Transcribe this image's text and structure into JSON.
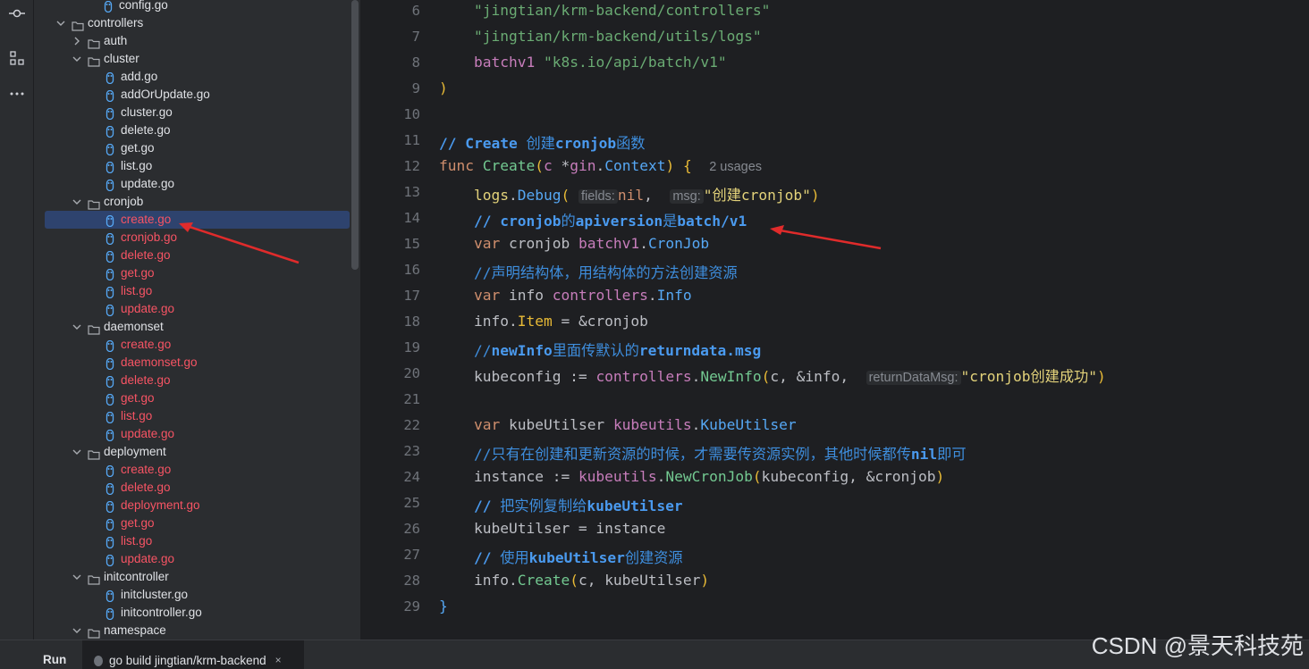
{
  "tree": {
    "items": [
      {
        "label": "config.go",
        "kind": "file",
        "depth": 4,
        "red": false
      },
      {
        "label": "controllers",
        "kind": "folder",
        "depth": 1,
        "open": true
      },
      {
        "label": "auth",
        "kind": "folder",
        "depth": 2,
        "open": false
      },
      {
        "label": "cluster",
        "kind": "folder",
        "depth": 2,
        "open": true
      },
      {
        "label": "add.go",
        "kind": "file",
        "depth": 3,
        "red": false
      },
      {
        "label": "addOrUpdate.go",
        "kind": "file",
        "depth": 3,
        "red": false
      },
      {
        "label": "cluster.go",
        "kind": "file",
        "depth": 3,
        "red": false
      },
      {
        "label": "delete.go",
        "kind": "file",
        "depth": 3,
        "red": false
      },
      {
        "label": "get.go",
        "kind": "file",
        "depth": 3,
        "red": false
      },
      {
        "label": "list.go",
        "kind": "file",
        "depth": 3,
        "red": false
      },
      {
        "label": "update.go",
        "kind": "file",
        "depth": 3,
        "red": false
      },
      {
        "label": "cronjob",
        "kind": "folder",
        "depth": 2,
        "open": true
      },
      {
        "label": "create.go",
        "kind": "file",
        "depth": 3,
        "red": true,
        "selected": true
      },
      {
        "label": "cronjob.go",
        "kind": "file",
        "depth": 3,
        "red": true
      },
      {
        "label": "delete.go",
        "kind": "file",
        "depth": 3,
        "red": true
      },
      {
        "label": "get.go",
        "kind": "file",
        "depth": 3,
        "red": true
      },
      {
        "label": "list.go",
        "kind": "file",
        "depth": 3,
        "red": true
      },
      {
        "label": "update.go",
        "kind": "file",
        "depth": 3,
        "red": true
      },
      {
        "label": "daemonset",
        "kind": "folder",
        "depth": 2,
        "open": true
      },
      {
        "label": "create.go",
        "kind": "file",
        "depth": 3,
        "red": true
      },
      {
        "label": "daemonset.go",
        "kind": "file",
        "depth": 3,
        "red": true
      },
      {
        "label": "delete.go",
        "kind": "file",
        "depth": 3,
        "red": true
      },
      {
        "label": "get.go",
        "kind": "file",
        "depth": 3,
        "red": true
      },
      {
        "label": "list.go",
        "kind": "file",
        "depth": 3,
        "red": true
      },
      {
        "label": "update.go",
        "kind": "file",
        "depth": 3,
        "red": true
      },
      {
        "label": "deployment",
        "kind": "folder",
        "depth": 2,
        "open": true
      },
      {
        "label": "create.go",
        "kind": "file",
        "depth": 3,
        "red": true
      },
      {
        "label": "delete.go",
        "kind": "file",
        "depth": 3,
        "red": true
      },
      {
        "label": "deployment.go",
        "kind": "file",
        "depth": 3,
        "red": true
      },
      {
        "label": "get.go",
        "kind": "file",
        "depth": 3,
        "red": true
      },
      {
        "label": "list.go",
        "kind": "file",
        "depth": 3,
        "red": true
      },
      {
        "label": "update.go",
        "kind": "file",
        "depth": 3,
        "red": true
      },
      {
        "label": "initcontroller",
        "kind": "folder",
        "depth": 2,
        "open": true
      },
      {
        "label": "initcluster.go",
        "kind": "file",
        "depth": 3,
        "red": false
      },
      {
        "label": "initcontroller.go",
        "kind": "file",
        "depth": 3,
        "red": false
      },
      {
        "label": "namespace",
        "kind": "folder",
        "depth": 2,
        "open": true
      }
    ]
  },
  "editor": {
    "lines": [
      {
        "n": "6",
        "html": "    <span class='str'>\"jingtian/krm-backend/controllers\"</span>"
      },
      {
        "n": "7",
        "html": "    <span class='str'>\"jingtian/krm-backend/utils/logs\"</span>"
      },
      {
        "n": "8",
        "html": "    <span class='field'>batchv1</span> <span class='str'>\"k8s.io/api/batch/v1\"</span>"
      },
      {
        "n": "9",
        "html": "<span class='par'>)</span>"
      },
      {
        "n": "10",
        "html": ""
      },
      {
        "n": "11",
        "html": "<span class='cmb'>// Create </span><span class='cm'>创建</span><span class='cmb'>cronjob</span><span class='cm'>函数</span>"
      },
      {
        "n": "12",
        "html": "<span class='kw'>func</span> <span class='fnG'>Create</span><span class='par'>(</span><span class='field'>c</span> *<span class='field'>gin</span>.<span class='fn'>Context</span><span class='par'>)</span> <span class='par'>{</span>  <span class='usages'>2 usages</span>"
      },
      {
        "n": "13",
        "html": "    <span class='strY'>logs</span>.<span class='fn'>Debug</span><span class='par'>(</span> <span class='hint'>fields:</span><span class='kw'>nil</span>,  <span class='hint'>msg:</span><span class='strY'>\"创建cronjob\"</span><span class='par'>)</span>"
      },
      {
        "n": "14",
        "html": "    <span class='cmb'>// cronjob</span><span class='cm'>的</span><span class='cmb'>apiversion</span><span class='cm'>是</span><span class='cmb'>batch/v1</span>"
      },
      {
        "n": "15",
        "html": "    <span class='kw'>var</span> cronjob <span class='field'>batchv1</span>.<span class='fn'>CronJob</span>"
      },
      {
        "n": "16",
        "html": "    <span class='cm'>//声明结构体，用结构体的方法创建资源</span>"
      },
      {
        "n": "17",
        "html": "    <span class='kw'>var</span> info <span class='field'>controllers</span>.<span class='fn'>Info</span>"
      },
      {
        "n": "18",
        "html": "    info.<span class='par'>Item</span> = &amp;cronjob"
      },
      {
        "n": "19",
        "html": "    <span class='cm'>//</span><span class='cmb'>newInfo</span><span class='cm'>里面传默认的</span><span class='cmb'>returndata.msg</span>"
      },
      {
        "n": "20",
        "html": "    kubeconfig := <span class='field'>controllers</span>.<span class='fnG'>NewInfo</span><span class='par'>(</span>c, &amp;info,  <span class='hint'>returnDataMsg:</span><span class='strY'>\"cronjob创建成功\"</span><span class='par'>)</span>"
      },
      {
        "n": "21",
        "html": ""
      },
      {
        "n": "22",
        "html": "    <span class='kw'>var</span> kubeUtilser <span class='field'>kubeutils</span>.<span class='fn'>KubeUtilser</span>"
      },
      {
        "n": "23",
        "html": "    <span class='cm'>//只有在创建和更新资源的时候，才需要传资源实例，其他时候都传</span><span class='cmb'>nil</span><span class='cm'>即可</span>"
      },
      {
        "n": "24",
        "html": "    instance := <span class='field'>kubeutils</span>.<span class='fnG'>NewCronJob</span><span class='par'>(</span>kubeconfig, &amp;cronjob<span class='par'>)</span>"
      },
      {
        "n": "25",
        "html": "    <span class='cmb'>// </span><span class='cm'>把实例复制给</span><span class='cmb'>kubeUtilser</span>"
      },
      {
        "n": "26",
        "html": "    kubeUtilser = instance"
      },
      {
        "n": "27",
        "html": "    <span class='cmb'>// </span><span class='cm'>使用</span><span class='cmb'>kubeUtilser</span><span class='cm'>创建资源</span>"
      },
      {
        "n": "28",
        "html": "    info.<span class='fnG'>Create</span><span class='par'>(</span>c, kubeUtilser<span class='par'>)</span>"
      },
      {
        "n": "29",
        "html": "<span class='fn'>}</span>"
      }
    ]
  },
  "bottom": {
    "run_label": "Run",
    "run_tab": "go build jingtian/krm-backend",
    "close": "×"
  },
  "watermark": "CSDN @景天科技苑",
  "icons": {
    "commit": "commit-icon",
    "structure": "structure-icon",
    "more": "more-icon"
  }
}
